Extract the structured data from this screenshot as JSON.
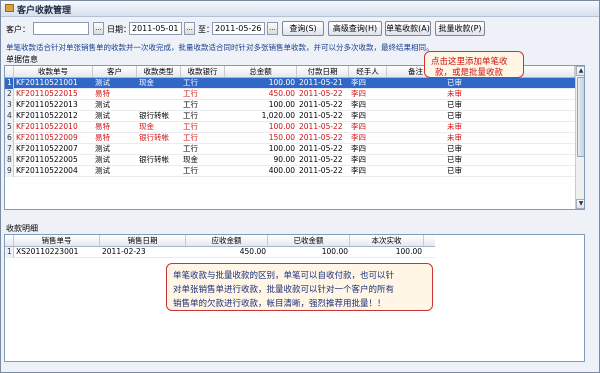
{
  "window": {
    "title": "客户收款管理"
  },
  "filter": {
    "customer_label": "客户：",
    "customer_value": "",
    "date_label": "日期：",
    "date_from": "2011-05-01",
    "date_to_label": "至：",
    "date_to": "2011-05-26",
    "browse_label": "...",
    "buttons": {
      "query": "查询(S)",
      "advanced": "高级查询(H)",
      "single": "单笔收款(A)",
      "batch": "批量收款(P)"
    }
  },
  "hint": "单笔收款适合针对单张销售单的收款并一次收完成，批量收款适合同时针对多张销售单收款，并可以分多次收款，最终结果相同。",
  "callout_top": {
    "line1": "点击这里添加单笔收",
    "line2": "款，或是批量收款"
  },
  "top_section": {
    "title": "单据信息",
    "columns": [
      "",
      "收款单号",
      "客户",
      "收款类型",
      "收款银行",
      "总金额",
      "付款日期",
      "经手人",
      "备注",
      ""
    ],
    "rows": [
      {
        "n": "1",
        "no": "KF20110521001",
        "customer": "测试",
        "type": "现金",
        "bank": "工行",
        "amount": "100.00",
        "date": "2011-05-21",
        "handler": "李四",
        "note": "",
        "status": "已审"
      },
      {
        "n": "2",
        "no": "KF20110522015",
        "customer": "易特",
        "type": "",
        "bank": "工行",
        "amount": "450.00",
        "date": "2011-05-22",
        "handler": "李四",
        "note": "",
        "status": "未审"
      },
      {
        "n": "3",
        "no": "KF20110522013",
        "customer": "测试",
        "type": "",
        "bank": "工行",
        "amount": "100.00",
        "date": "2011-05-22",
        "handler": "李四",
        "note": "",
        "status": "已审"
      },
      {
        "n": "4",
        "no": "KF20110522012",
        "customer": "测试",
        "type": "银行转帐",
        "bank": "工行",
        "amount": "1,020.00",
        "date": "2011-05-22",
        "handler": "李四",
        "note": "",
        "status": "已审"
      },
      {
        "n": "5",
        "no": "KF20110522010",
        "customer": "易特",
        "type": "现金",
        "bank": "工行",
        "amount": "100.00",
        "date": "2011-05-22",
        "handler": "李四",
        "note": "",
        "status": "未审"
      },
      {
        "n": "6",
        "no": "KF20110522009",
        "customer": "易特",
        "type": "银行转帐",
        "bank": "工行",
        "amount": "150.00",
        "date": "2011-05-22",
        "handler": "李四",
        "note": "",
        "status": "未审"
      },
      {
        "n": "7",
        "no": "KF20110522007",
        "customer": "测试",
        "type": "",
        "bank": "工行",
        "amount": "100.00",
        "date": "2011-05-22",
        "handler": "李四",
        "note": "",
        "status": "已审"
      },
      {
        "n": "8",
        "no": "KF20110522005",
        "customer": "测试",
        "type": "银行转帐",
        "bank": "现金",
        "amount": "90.00",
        "date": "2011-05-22",
        "handler": "李四",
        "note": "",
        "status": "已审"
      },
      {
        "n": "9",
        "no": "KF20110522004",
        "customer": "测试",
        "type": "",
        "bank": "工行",
        "amount": "400.00",
        "date": "2011-05-22",
        "handler": "李四",
        "note": "",
        "status": "已审"
      }
    ]
  },
  "bottom_section": {
    "title": "收款明细",
    "columns": [
      "",
      "销售单号",
      "销售日期",
      "应收金额",
      "已收金额",
      "本次实收"
    ],
    "rows": [
      {
        "n": "1",
        "no": "XS20110223001",
        "date": "2011-02-23",
        "due": "450.00",
        "received": "100.00",
        "this_time": "100.00"
      }
    ]
  },
  "callout_bottom": {
    "line1": "单笔收款与批量收款的区别，单笔可以自收付款，也可以针",
    "line2": "对单张销售单进行收款，批量收款可以针对一个客户的所有",
    "line3": "销售单的欠款进行收款，帐目清晰，强烈推荐用批量！！"
  },
  "colors": {
    "selection": "#3168c6",
    "unaudited_text": "#d01010",
    "callout_border": "#cc3333"
  }
}
